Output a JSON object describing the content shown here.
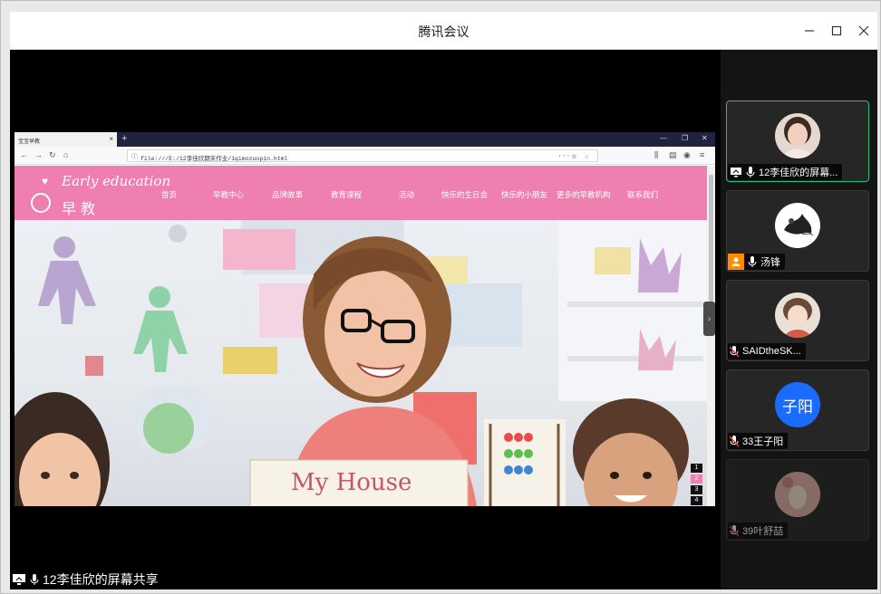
{
  "window": {
    "title": "腾讯会议"
  },
  "browser": {
    "tab_title": "宝宝早教",
    "address": "file:///E:/12李佳欣期末作业/1qimozuopin.html"
  },
  "site": {
    "logo_en": "Early education",
    "logo_zh": "早教",
    "menu": [
      "首页",
      "早教中心",
      "品牌故事",
      "教育课程",
      "活动",
      "快乐的生日会",
      "快乐的小朋友",
      "更多的早教机构",
      "联系我们"
    ],
    "pager": [
      "1",
      "2",
      "3",
      "4"
    ],
    "hero_text": "My House"
  },
  "participants": [
    {
      "name": "12李佳欣的屏幕...",
      "sharing": true,
      "muted": false,
      "avatar": "photo-girl"
    },
    {
      "name": "汤锋",
      "host": true,
      "muted": false,
      "avatar": "ink-painting"
    },
    {
      "name": "SAIDtheSK...",
      "muted": true,
      "avatar": "anime-boy"
    },
    {
      "name": "33王子阳",
      "muted": true,
      "avatar": "initials",
      "initials": "子阳"
    },
    {
      "name": "39叶舒喆",
      "muted": true,
      "dimmed": true,
      "avatar": "cartoon"
    }
  ],
  "share_label": "12李佳欣的屏幕共享",
  "colors": {
    "accent_green": "#1fc37f",
    "site_pink": "#ee7fb0",
    "avatar_blue": "#1a6cff",
    "host_orange": "#ff8a00"
  }
}
